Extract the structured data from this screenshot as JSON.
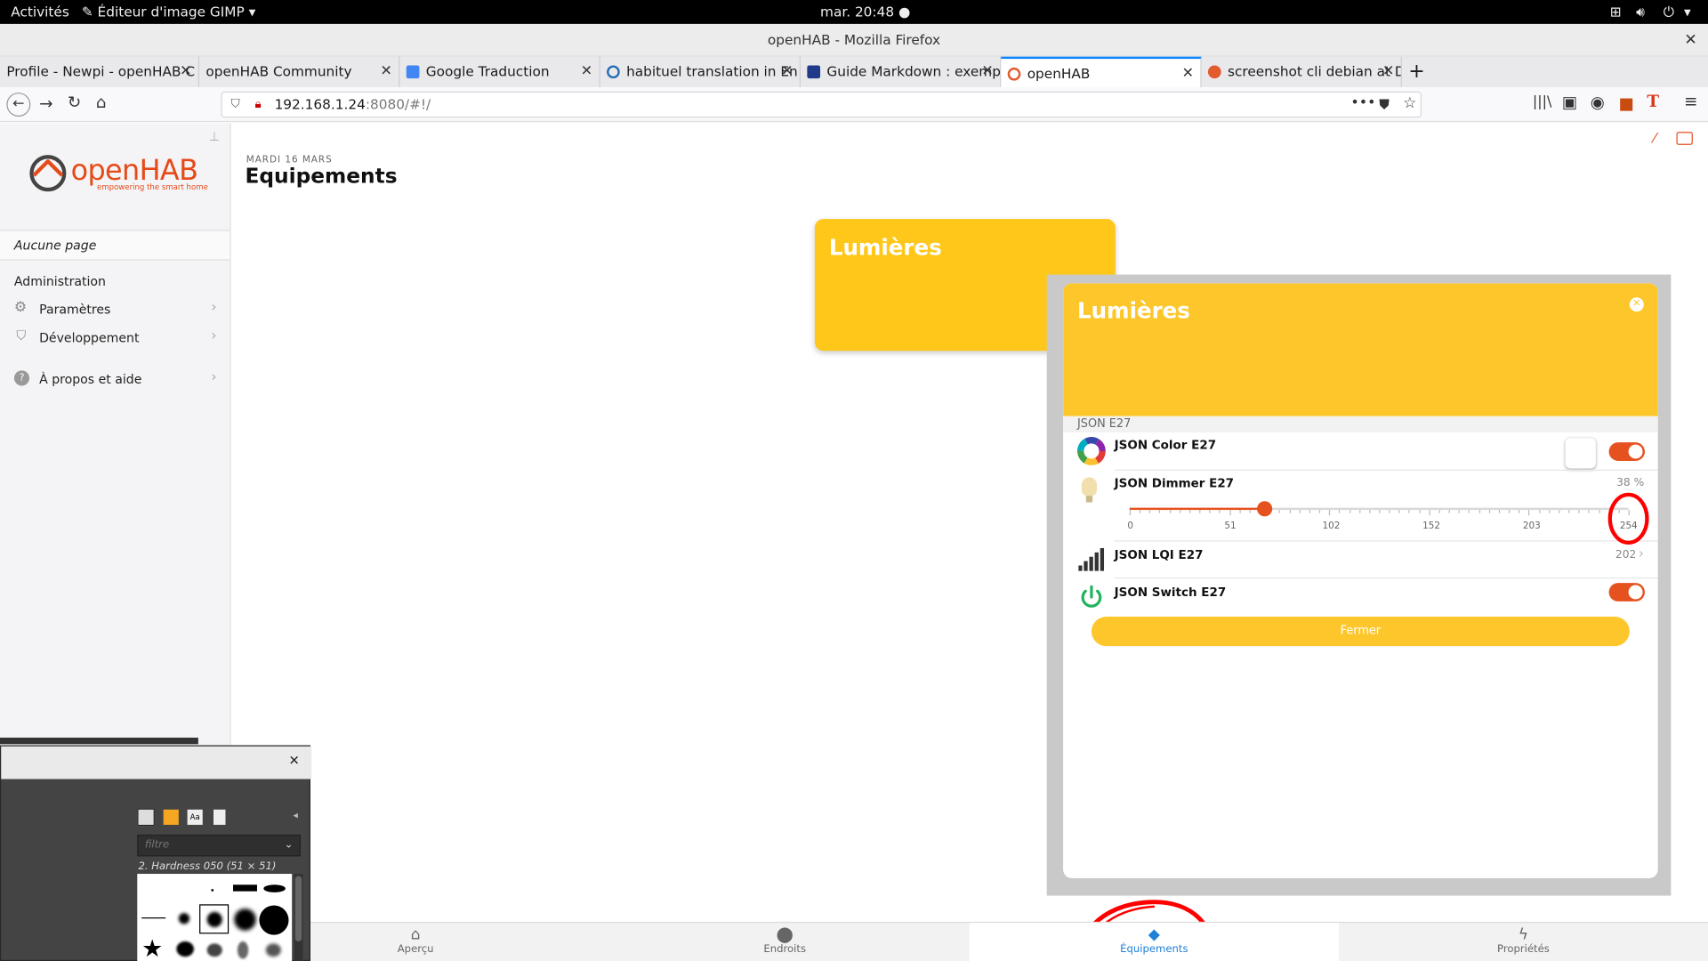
{
  "gnome": {
    "activities": "Activités",
    "app_menu": "Éditeur d'image GIMP",
    "clock": "mar. 20:48"
  },
  "firefox": {
    "window_title": "openHAB - Mozilla Firefox",
    "tabs": [
      {
        "label": "Profile - Newpi - openHAB C",
        "color": "#e35b2e"
      },
      {
        "label": "openHAB Community",
        "color": ""
      },
      {
        "label": "Google Traduction",
        "color": "#4285f4"
      },
      {
        "label": "habituel translation in En",
        "color": "#2a6fb5"
      },
      {
        "label": "Guide Markdown : exemp",
        "color": "#1f3b8a"
      },
      {
        "label": "openHAB",
        "color": "#e35b2e"
      },
      {
        "label": "screenshot cli debian at D",
        "color": "#e35b2e"
      }
    ],
    "url_host": "192.168.1.24",
    "url_rest": ":8080/#!/",
    "active_tab_index": 5
  },
  "sidebar": {
    "logo_text": "openHAB",
    "logo_tagline": "empowering the smart home",
    "no_page": "Aucune page",
    "section": "Administration",
    "items": [
      {
        "label": "Paramètres",
        "icon": "gear-icon"
      },
      {
        "label": "Développement",
        "icon": "shield-icon"
      },
      {
        "label": "À propos et aide",
        "icon": "help-icon"
      }
    ]
  },
  "main": {
    "date": "MARDI 16 MARS",
    "title": "Equipements",
    "card_title": "Lumières"
  },
  "popup": {
    "title": "Lumières",
    "group_label": "JSON E27",
    "color_item": "JSON Color E27",
    "dimmer_item": "JSON Dimmer E27",
    "dimmer_value": "38 %",
    "dimmer_fraction": 0.27,
    "slider_ticks": [
      "0",
      "51",
      "102",
      "152",
      "203",
      "254"
    ],
    "lqi_item": "JSON LQI E27",
    "lqi_value": "202",
    "switch_item": "JSON Switch E27",
    "close_button": "Fermer",
    "accent": "#e55220",
    "header_color": "#fdc72c"
  },
  "tabbar": [
    {
      "label": "Aperçu",
      "icon": "home-icon"
    },
    {
      "label": "Endroits",
      "icon": "pin-icon"
    },
    {
      "label": "Équipements",
      "icon": "cube-icon"
    },
    {
      "label": "Propriétés",
      "icon": "bolt-icon"
    }
  ],
  "gimp": {
    "filter_placeholder": "filtre",
    "brush_name": "2. Hardness 050 (51 × 51)"
  }
}
